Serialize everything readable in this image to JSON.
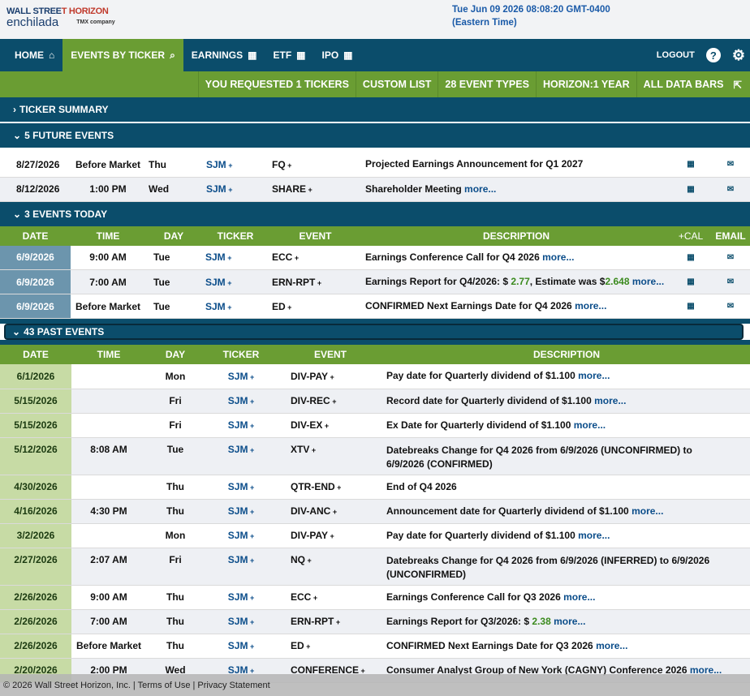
{
  "logo": {
    "line1_a": "WALL STREE",
    "line1_b": "T HORIZON",
    "line2": "enchilada",
    "tmx": "TMX company"
  },
  "clock": {
    "line1": "Tue Jun 09 2026 08:08:20 GMT-0400",
    "line2": "(Eastern Time)"
  },
  "nav": {
    "items": [
      {
        "label": "HOME",
        "icon": "home-icon",
        "glyph": "⌂"
      },
      {
        "label": "EVENTS BY TICKER",
        "icon": "search-icon",
        "glyph": "⌕"
      },
      {
        "label": "EARNINGS",
        "icon": "calendar-icon",
        "glyph": "▦"
      },
      {
        "label": "ETF",
        "icon": "calendar-icon",
        "glyph": "▦"
      },
      {
        "label": "IPO",
        "icon": "calendar-icon",
        "glyph": "▦"
      }
    ],
    "logout": "LOGOUT",
    "help": "?",
    "gear": "⚙"
  },
  "greenbar": [
    "YOU REQUESTED 1 TICKERS",
    "CUSTOM LIST",
    "28 EVENT TYPES",
    "HORIZON:1 YEAR",
    "ALL DATA BARS"
  ],
  "sections": {
    "ticker_summary": "TICKER SUMMARY",
    "future": "5 FUTURE EVENTS",
    "today": "3 EVENTS TODAY",
    "past": "43 PAST EVENTS"
  },
  "future_events": [
    {
      "date": "8/27/2026",
      "time": "Before Market",
      "day": "Thu",
      "ticker": "SJM",
      "event": "FQ",
      "desc": "Projected Earnings Announcement for Q1 2027",
      "more": ""
    },
    {
      "date": "8/12/2026",
      "time": "1:00 PM",
      "day": "Wed",
      "ticker": "SJM",
      "event": "SHARE",
      "desc": "Shareholder Meeting",
      "more": "more..."
    }
  ],
  "today_headers": [
    "DATE",
    "TIME",
    "DAY",
    "TICKER",
    "EVENT",
    "DESCRIPTION",
    "+CAL",
    "EMAIL"
  ],
  "today_events": [
    {
      "date": "6/9/2026",
      "time": "9:00 AM",
      "day": "Tue",
      "ticker": "SJM",
      "event": "ECC",
      "desc": "Earnings Conference Call for Q4 2026",
      "more": "more..."
    },
    {
      "date": "6/9/2026",
      "time": "7:00 AM",
      "day": "Tue",
      "ticker": "SJM",
      "event": "ERN-RPT",
      "desc": "Earnings Report for Q4/2026: $ ",
      "num1": "2.77",
      "desc2": ", Estimate was $",
      "num2": "2.648",
      "more": "more..."
    },
    {
      "date": "6/9/2026",
      "time": "Before Market",
      "day": "Tue",
      "ticker": "SJM",
      "event": "ED",
      "desc": "CONFIRMED Next Earnings Date for Q4 2026",
      "more": "more..."
    }
  ],
  "past_headers": [
    "DATE",
    "TIME",
    "DAY",
    "TICKER",
    "EVENT",
    "DESCRIPTION"
  ],
  "past_events": [
    {
      "date": "6/1/2026",
      "time": "",
      "day": "Mon",
      "ticker": "SJM",
      "event": "DIV-PAY",
      "desc": "Pay date for Quarterly dividend of $1.100",
      "more": "more..."
    },
    {
      "date": "5/15/2026",
      "time": "",
      "day": "Fri",
      "ticker": "SJM",
      "event": "DIV-REC",
      "desc": "Record date for Quarterly dividend of $1.100",
      "more": "more..."
    },
    {
      "date": "5/15/2026",
      "time": "",
      "day": "Fri",
      "ticker": "SJM",
      "event": "DIV-EX",
      "desc": "Ex Date for Quarterly dividend of $1.100",
      "more": "more..."
    },
    {
      "date": "5/12/2026",
      "time": "8:08 AM",
      "day": "Tue",
      "ticker": "SJM",
      "event": "XTV",
      "desc": "Datebreaks Change for Q4 2026 from 6/9/2026 (UNCONFIRMED) to 6/9/2026 (CONFIRMED)",
      "more": ""
    },
    {
      "date": "4/30/2026",
      "time": "",
      "day": "Thu",
      "ticker": "SJM",
      "event": "QTR-END",
      "desc": "End of Q4 2026",
      "more": ""
    },
    {
      "date": "4/16/2026",
      "time": "4:30 PM",
      "day": "Thu",
      "ticker": "SJM",
      "event": "DIV-ANC",
      "desc": "Announcement date for Quarterly dividend of $1.100",
      "more": "more..."
    },
    {
      "date": "3/2/2026",
      "time": "",
      "day": "Mon",
      "ticker": "SJM",
      "event": "DIV-PAY",
      "desc": "Pay date for Quarterly dividend of $1.100",
      "more": "more..."
    },
    {
      "date": "2/27/2026",
      "time": "2:07 AM",
      "day": "Fri",
      "ticker": "SJM",
      "event": "NQ",
      "desc": "Datebreaks Change for Q4 2026 from 6/9/2026 (INFERRED) to 6/9/2026 (UNCONFIRMED)",
      "more": ""
    },
    {
      "date": "2/26/2026",
      "time": "9:00 AM",
      "day": "Thu",
      "ticker": "SJM",
      "event": "ECC",
      "desc": "Earnings Conference Call for Q3 2026",
      "more": "more..."
    },
    {
      "date": "2/26/2026",
      "time": "7:00 AM",
      "day": "Thu",
      "ticker": "SJM",
      "event": "ERN-RPT",
      "desc": "Earnings Report for Q3/2026: $ ",
      "num1": "2.38",
      "more": "more..."
    },
    {
      "date": "2/26/2026",
      "time": "Before Market",
      "day": "Thu",
      "ticker": "SJM",
      "event": "ED",
      "desc": "CONFIRMED Next Earnings Date for Q3 2026",
      "more": "more..."
    },
    {
      "date": "2/20/2026",
      "time": "2:00 PM",
      "day": "Wed",
      "ticker": "SJM",
      "event": "CONFERENCE",
      "desc": "Consumer Analyst Group of New York (CAGNY) Conference 2026",
      "more": "more..."
    }
  ],
  "footer": "© 2026 Wall Street Horizon, Inc. | Terms of Use | Privacy Statement"
}
